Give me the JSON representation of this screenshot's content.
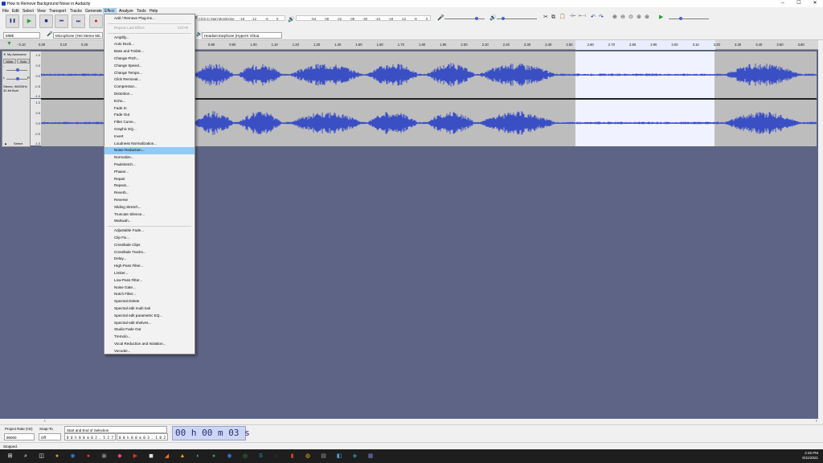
{
  "window": {
    "title": "How to Remove Background Noise in Audacity",
    "min_glyph": "–",
    "max_glyph": "☐",
    "close_glyph": "✕"
  },
  "menubar": [
    "File",
    "Edit",
    "Select",
    "View",
    "Transport",
    "Tracks",
    "Generate",
    "Effect",
    "Analyze",
    "Tools",
    "Help"
  ],
  "toolbar": {
    "pause": "❚❚",
    "play": "▶",
    "stop": "■",
    "skip_start": "⏮",
    "skip_end": "⏭",
    "record": "●",
    "monitor_label": "Click to Start Monitoring",
    "record_meter_ticks": [
      "-18",
      "-12",
      "-6",
      "0"
    ],
    "play_meter_ticks": [
      "-54",
      "-48",
      "-42",
      "-36",
      "-30",
      "-24",
      "-18",
      "-12",
      "-6",
      "0"
    ],
    "edit_icons": [
      "✂",
      "⧉",
      "📋",
      "⊣⊢",
      "⊢⊣"
    ],
    "undo": "↶",
    "redo": "↷",
    "zoom_icons": [
      "⊕",
      "⊖",
      "⊙",
      "⊚",
      "⊛"
    ],
    "play_at_speed": "▶"
  },
  "devicebar": {
    "host": "MME",
    "record_device": "Microphone (Yeti Stereo Mic",
    "output_device": "Headset Earphone (HyperX Virtua"
  },
  "ruler": {
    "left_ticks": [
      "- 0.10",
      "0.00",
      "0.10",
      "0.20"
    ],
    "right_ticks": [
      "0.80",
      "0.90",
      "1.00",
      "1.10",
      "1.20",
      "1.30",
      "1.40",
      "1.50",
      "1.60",
      "1.70",
      "1.80",
      "1.90",
      "2.00",
      "2.10",
      "2.20",
      "2.30",
      "2.40",
      "2.50",
      "2.60",
      "2.70",
      "2.80",
      "2.90",
      "3.00",
      "3.10",
      "3.20",
      "3.30",
      "3.40",
      "3.50",
      "3.60"
    ],
    "sel_ticks": [
      "2.60",
      "2.75",
      "2.80",
      "2.90",
      "3.00",
      "3.10"
    ]
  },
  "track": {
    "name": "My Awesome",
    "mute": "Mute",
    "solo": "Solo",
    "info": "Stereo, 96000Hz",
    "format": "32-bit float",
    "select": "Select",
    "collapse": "▲",
    "scale": [
      "1.0",
      "0.5",
      "0.0",
      "-0.5",
      "-1.0"
    ]
  },
  "effect_menu": [
    {
      "label": "Add / Remove Plug-ins...",
      "shortcut": ""
    },
    {
      "sep": true
    },
    {
      "label": "Repeat Last Effect",
      "shortcut": "Ctrl+R",
      "disabled": true
    },
    {
      "sep": true
    },
    {
      "label": "Amplify..."
    },
    {
      "label": "Auto Duck..."
    },
    {
      "label": "Bass and Treble..."
    },
    {
      "label": "Change Pitch..."
    },
    {
      "label": "Change Speed..."
    },
    {
      "label": "Change Tempo..."
    },
    {
      "label": "Click Removal..."
    },
    {
      "label": "Compressor..."
    },
    {
      "label": "Distortion..."
    },
    {
      "label": "Echo..."
    },
    {
      "label": "Fade In"
    },
    {
      "label": "Fade Out"
    },
    {
      "label": "Filter Curve..."
    },
    {
      "label": "Graphic EQ..."
    },
    {
      "label": "Invert"
    },
    {
      "label": "Loudness Normalization..."
    },
    {
      "label": "Noise Reduction...",
      "highlight": true
    },
    {
      "label": "Normalize..."
    },
    {
      "label": "Paulstretch..."
    },
    {
      "label": "Phaser..."
    },
    {
      "label": "Repair"
    },
    {
      "label": "Repeat..."
    },
    {
      "label": "Reverb..."
    },
    {
      "label": "Reverse"
    },
    {
      "label": "Sliding Stretch..."
    },
    {
      "label": "Truncate Silence..."
    },
    {
      "label": "Wahwah..."
    },
    {
      "sep": true
    },
    {
      "label": "Adjustable Fade..."
    },
    {
      "label": "Clip Fix..."
    },
    {
      "label": "Crossfade Clips"
    },
    {
      "label": "Crossfade Tracks..."
    },
    {
      "label": "Delay..."
    },
    {
      "label": "High-Pass Filter..."
    },
    {
      "label": "Limiter..."
    },
    {
      "label": "Low-Pass Filter..."
    },
    {
      "label": "Noise Gate..."
    },
    {
      "label": "Notch Filter..."
    },
    {
      "label": "Spectral Delete"
    },
    {
      "label": "Spectral edit multi tool"
    },
    {
      "label": "Spectral edit parametric EQ..."
    },
    {
      "label": "Spectral edit shelves..."
    },
    {
      "label": "Studio Fade Out"
    },
    {
      "label": "Tremolo..."
    },
    {
      "label": "Vocal Reduction and Isolation..."
    },
    {
      "label": "Vocoder..."
    }
  ],
  "selection_bar": {
    "rate_label": "Project Rate (Hz)",
    "rate_value": "96000",
    "snap_label": "Snap-To",
    "snap_value": "Off",
    "mode": "Start and End of Selection",
    "start_time": "0 0 h 0 0 m 0 2 . 5 2 7 s",
    "end_time": "0 0 h 0 0 m 0 3 . 1 8 2 s",
    "audio_position": "00 h 00 m 03 s"
  },
  "status": "Stopped.",
  "taskbar": {
    "time": "2:45 PM",
    "date": "8/11/2021",
    "icons": [
      "⊞",
      "⌕",
      "◫",
      "●",
      "◉",
      "●",
      "▣",
      "◆",
      "▶",
      "◼",
      "◢",
      "▲",
      "◐",
      "●",
      "◉",
      "◎",
      "S",
      "◌",
      "▮",
      "◍",
      "▤",
      "◧",
      "◈",
      "▦"
    ]
  },
  "colors": {
    "wave": "#3b4fc4",
    "highlight": "#91c9f7",
    "background": "#5e6485"
  }
}
